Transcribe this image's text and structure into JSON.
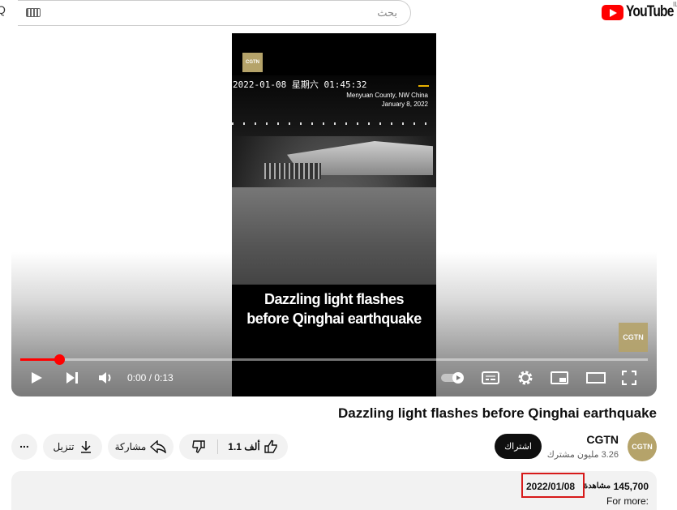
{
  "header": {
    "search_placeholder": "بحث",
    "keyboard_icon": "keyboard-icon",
    "search_icon": "search-icon",
    "logo_text": "YouTube",
    "logo_superscript": "IL"
  },
  "video": {
    "logo_small": "CGTN",
    "timestamp": "2022-01-08 星期六 01:45:32",
    "location_line1": "Menyuan County, NW China",
    "location_line2": "January 8, 2022",
    "caption_line1": "Dazzling light flashes",
    "caption_line2": "before Qinghai earthquake",
    "watermark": "CGTN",
    "progress_fraction": 0.06,
    "time": "0:00 / 0:13",
    "accent_color": "#ff0000"
  },
  "controls": {
    "play": "play-icon",
    "next": "next-icon",
    "volume": "volume-icon",
    "autoplay": "autoplay-toggle-icon",
    "subtitles": "subtitles-icon",
    "settings": "gear-icon",
    "miniplayer": "miniplayer-icon",
    "theater": "theater-icon",
    "fullscreen": "fullscreen-icon"
  },
  "meta": {
    "title": "Dazzling light flashes before Qinghai earthquake",
    "channel_name": "CGTN",
    "subscribers": "3.26 مليون مشترك",
    "avatar_text": "CGTN",
    "subscribe_label": "اشتراك",
    "like_count": "1.1 ألف",
    "share_label": "مشاركة",
    "download_label": "تنزيل",
    "more_label": "..."
  },
  "description": {
    "views": "145,700",
    "views_label": "مشاهدة",
    "date": "2022/01/08",
    "text": "For more:"
  }
}
